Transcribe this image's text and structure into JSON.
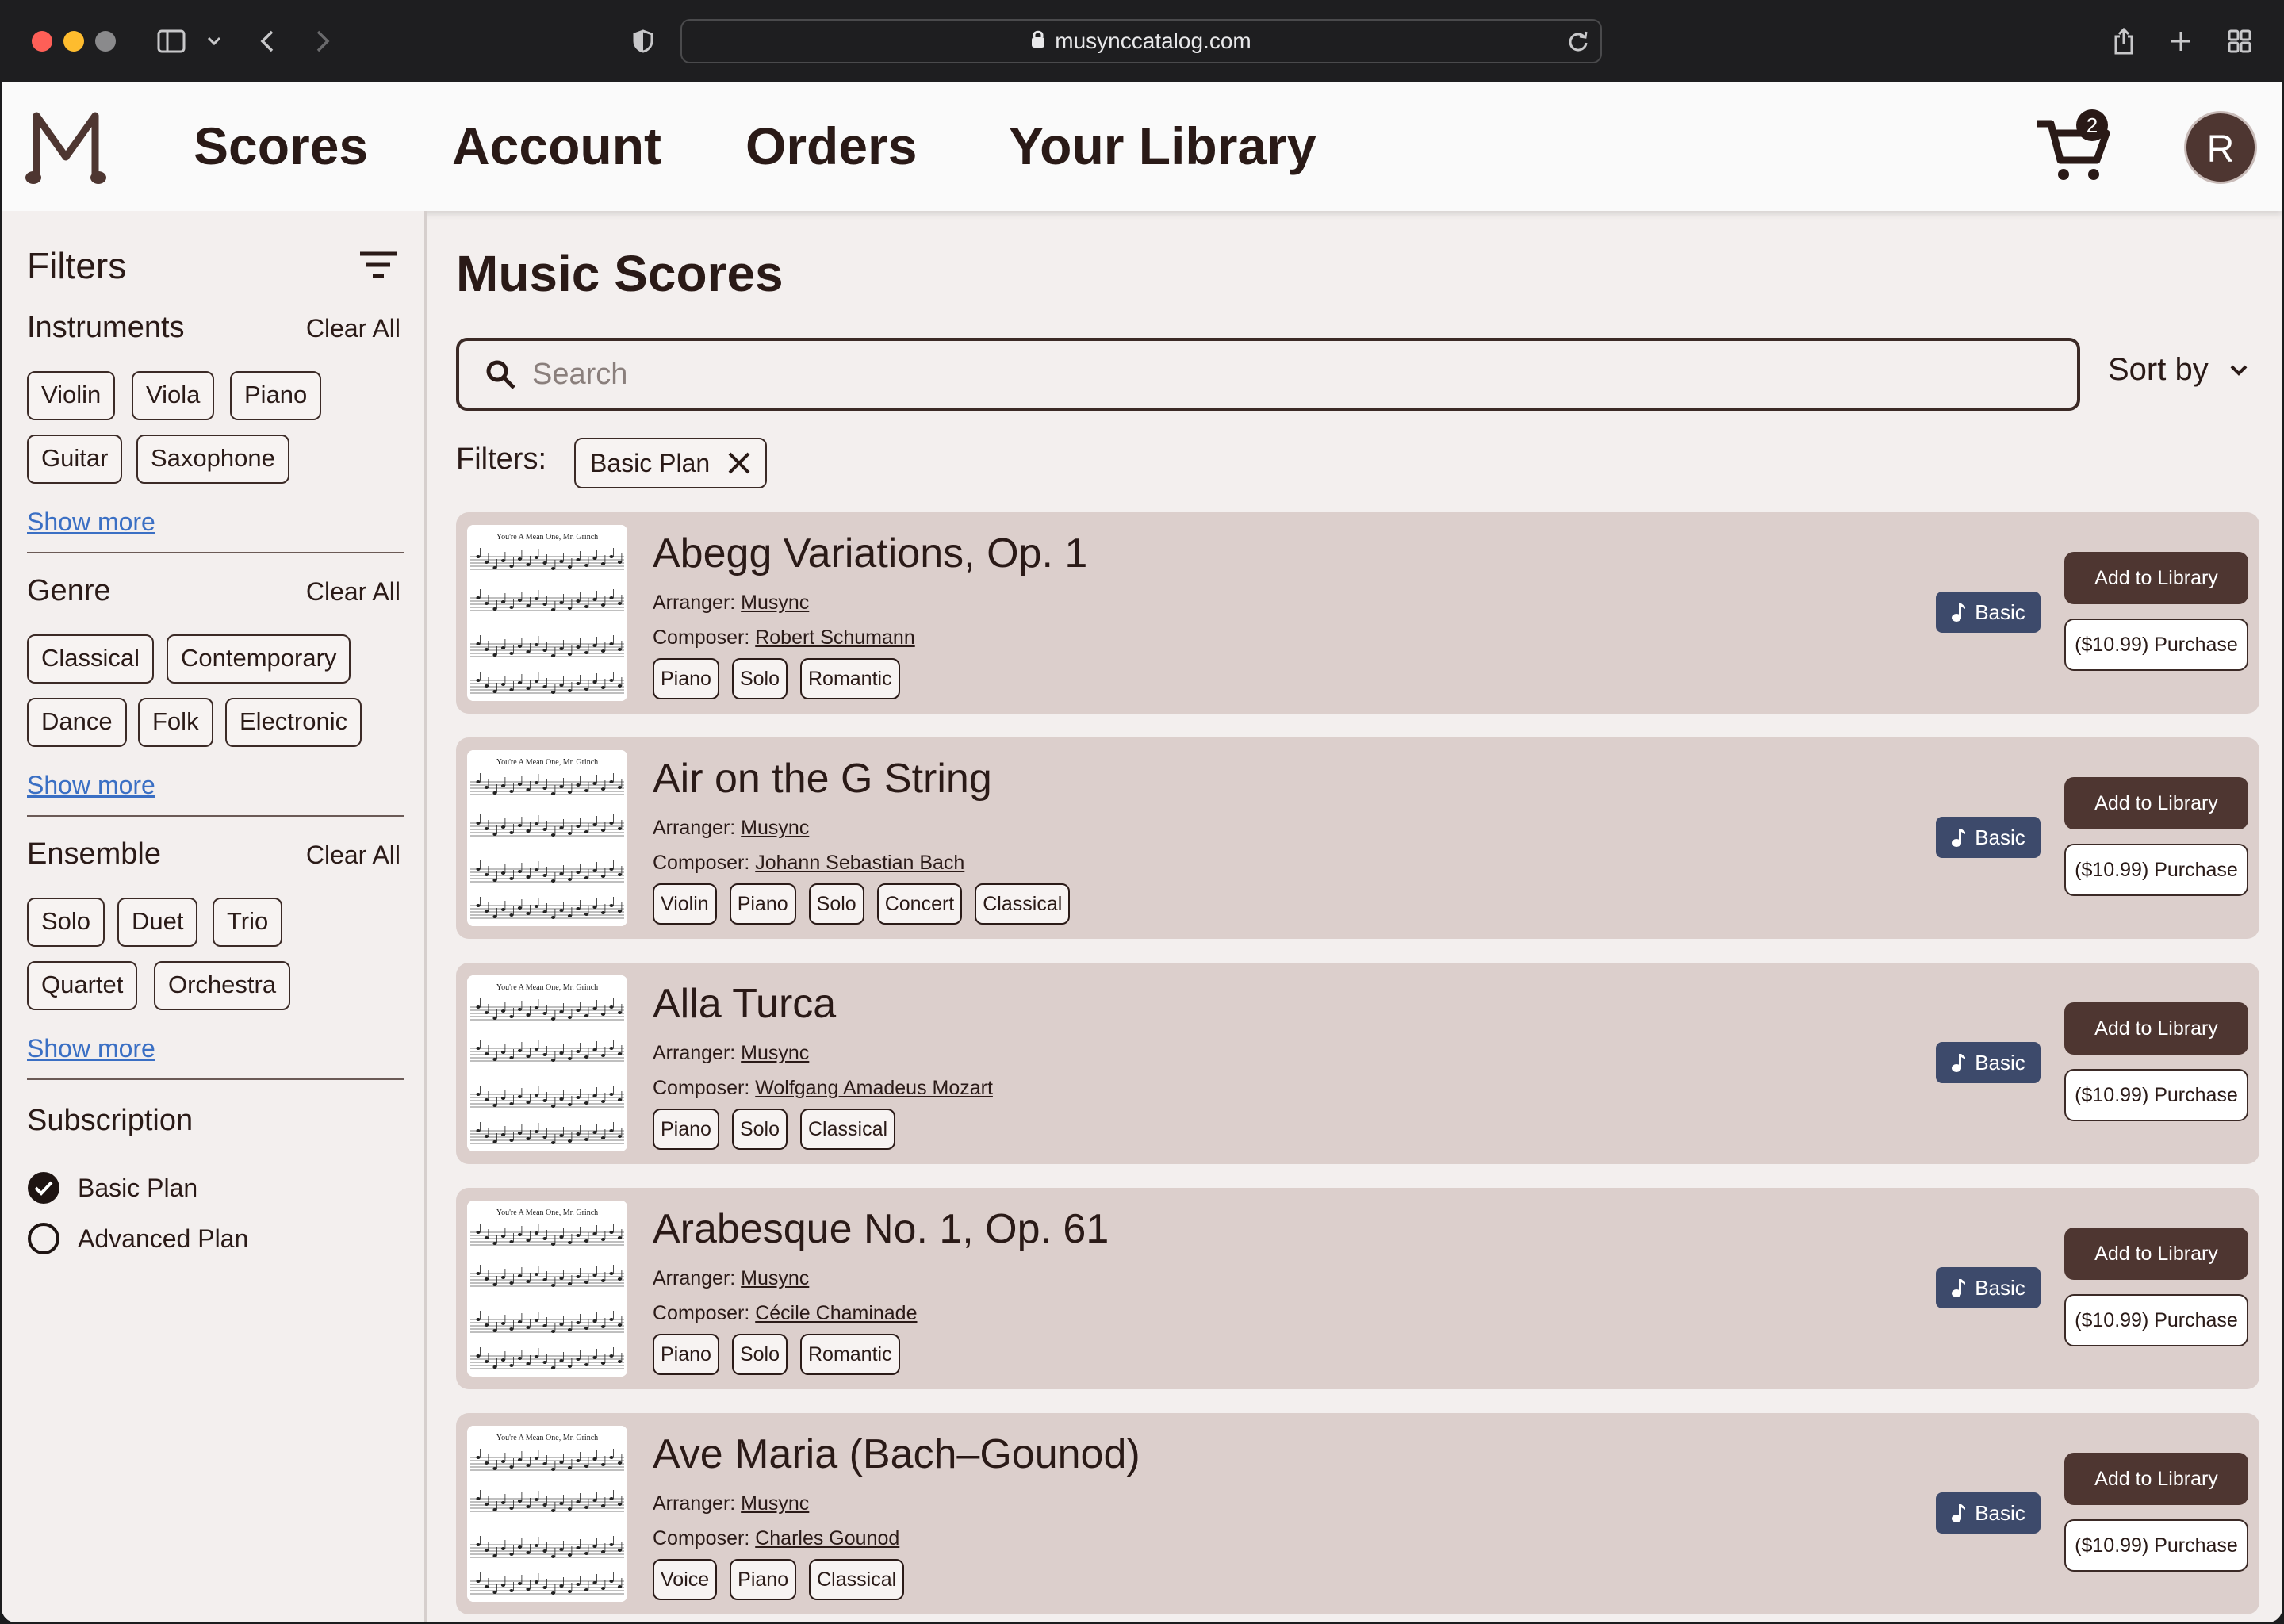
{
  "browser": {
    "url": "musynccatalog.com"
  },
  "nav": {
    "items": [
      {
        "label": "Scores",
        "active": true
      },
      {
        "label": "Account",
        "active": false
      },
      {
        "label": "Orders",
        "active": false
      },
      {
        "label": "Your Library",
        "active": false
      }
    ],
    "cart_count": "2",
    "avatar_initial": "R"
  },
  "sidebar": {
    "title": "Filters",
    "clear_label": "Clear All",
    "show_more_label": "Show more",
    "instruments": {
      "title": "Instruments",
      "chips": [
        "Violin",
        "Viola",
        "Piano",
        "Guitar",
        "Saxophone"
      ]
    },
    "genre": {
      "title": "Genre",
      "chips": [
        "Classical",
        "Contemporary",
        "Dance",
        "Folk",
        "Electronic"
      ]
    },
    "ensemble": {
      "title": "Ensemble",
      "chips": [
        "Solo",
        "Duet",
        "Trio",
        "Quartet",
        "Orchestra"
      ]
    },
    "subscription": {
      "title": "Subscription",
      "options": [
        {
          "label": "Basic Plan",
          "checked": true
        },
        {
          "label": "Advanced Plan",
          "checked": false
        }
      ]
    }
  },
  "main": {
    "title": "Music Scores",
    "search_placeholder": "Search",
    "sort_label": "Sort by",
    "filters_label": "Filters:",
    "active_filter": "Basic Plan",
    "arranger_label": "Arranger:",
    "composer_label": "Composer:",
    "badge_label": "Basic",
    "add_label": "Add to Library",
    "purchase_label": "($10.99) Purchase",
    "thumb_caption": "You're A Mean One, Mr. Grinch",
    "scores": [
      {
        "title": "Abegg Variations, Op. 1",
        "arranger": "Musync",
        "composer": "Robert Schumann",
        "tags": [
          "Piano",
          "Solo",
          "Romantic"
        ]
      },
      {
        "title": "Air on the G String",
        "arranger": "Musync",
        "composer": "Johann Sebastian Bach",
        "tags": [
          "Violin",
          "Piano",
          "Solo",
          "Concert",
          "Classical"
        ]
      },
      {
        "title": "Alla Turca",
        "arranger": "Musync",
        "composer": "Wolfgang Amadeus Mozart",
        "tags": [
          "Piano",
          "Solo",
          "Classical"
        ]
      },
      {
        "title": "Arabesque No. 1, Op. 61",
        "arranger": "Musync",
        "composer": "Cécile Chaminade",
        "tags": [
          "Piano",
          "Solo",
          "Romantic"
        ]
      },
      {
        "title": "Ave Maria (Bach–Gounod)",
        "arranger": "Musync",
        "composer": "Charles Gounod",
        "tags": [
          "Voice",
          "Piano",
          "Classical"
        ]
      }
    ]
  },
  "colors": {
    "accent": "#4e3631",
    "card_bg": "#dccfcc",
    "badge": "#3d4a6b",
    "link": "#3a6fc4"
  }
}
